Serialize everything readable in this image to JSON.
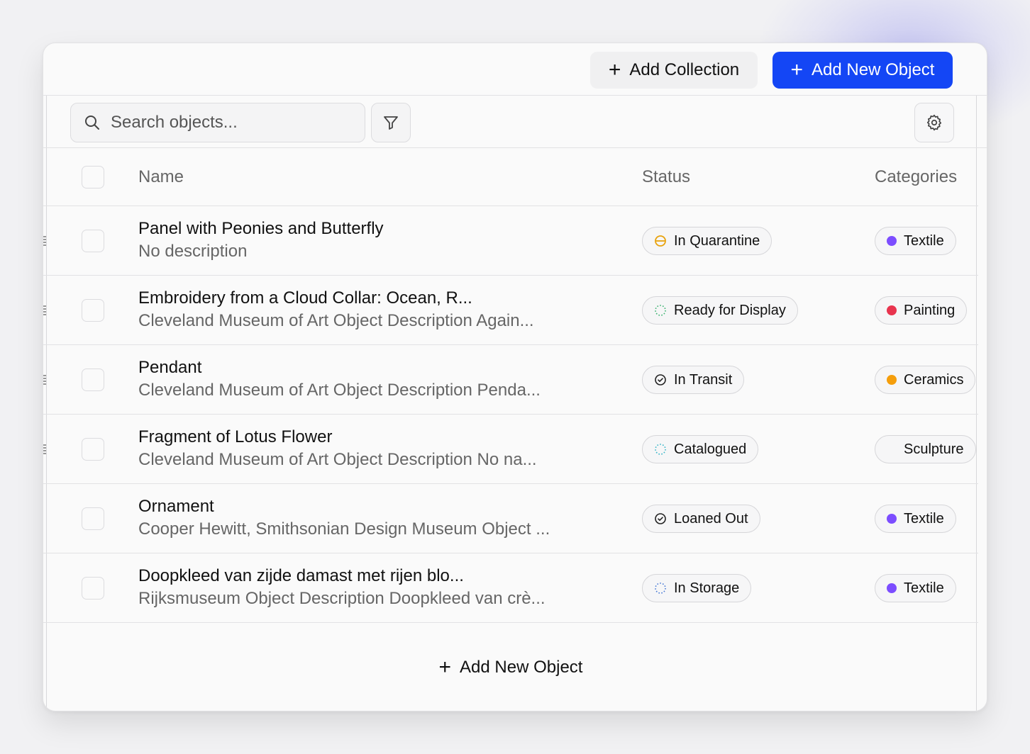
{
  "header": {
    "add_collection_label": "Add Collection",
    "add_new_object_label": "Add New Object",
    "primary_color": "#1446f5"
  },
  "toolbar": {
    "search_placeholder": "Search objects...",
    "filter_icon": "filter-icon",
    "settings_icon": "gear-icon"
  },
  "table": {
    "columns": {
      "name": "Name",
      "status": "Status",
      "categories": "Categories"
    },
    "rows": [
      {
        "title": "Panel with Peonies and Butterfly",
        "description": "No description",
        "status": "In Quarantine",
        "status_icon": "half-circle-icon",
        "category": "Textile",
        "category_color": "#7c4dff"
      },
      {
        "title": "Embroidery from a Cloud Collar: Ocean, R...",
        "description": "Cleveland Museum of Art Object Description Again...",
        "status": "Ready for Display",
        "status_icon": "dotted-circle-icon",
        "category": "Painting",
        "category_color": "#e8344e"
      },
      {
        "title": "Pendant",
        "description": "Cleveland Museum of Art Object Description Penda...",
        "status": "In Transit",
        "status_icon": "check-circle-icon",
        "category": "Ceramics",
        "category_color": "#f59e0b"
      },
      {
        "title": "Fragment of Lotus Flower",
        "description": "Cleveland Museum of Art Object Description No na...",
        "status": "Catalogued",
        "status_icon": "dotted-circle-icon",
        "category": "Sculpture",
        "category_color": ""
      },
      {
        "title": "Ornament",
        "description": "Cooper Hewitt, Smithsonian Design Museum Object ...",
        "status": "Loaned Out",
        "status_icon": "check-circle-icon",
        "category": "Textile",
        "category_color": "#7c4dff"
      },
      {
        "title": "Doopkleed van zijde damast met rijen blo...",
        "description": "Rijksmuseum Object Description Doopkleed van crè...",
        "status": "In Storage",
        "status_icon": "dotted-circle-icon",
        "category": "Textile",
        "category_color": "#7c4dff"
      }
    ]
  },
  "footer": {
    "add_new_object_label": "Add New Object"
  }
}
